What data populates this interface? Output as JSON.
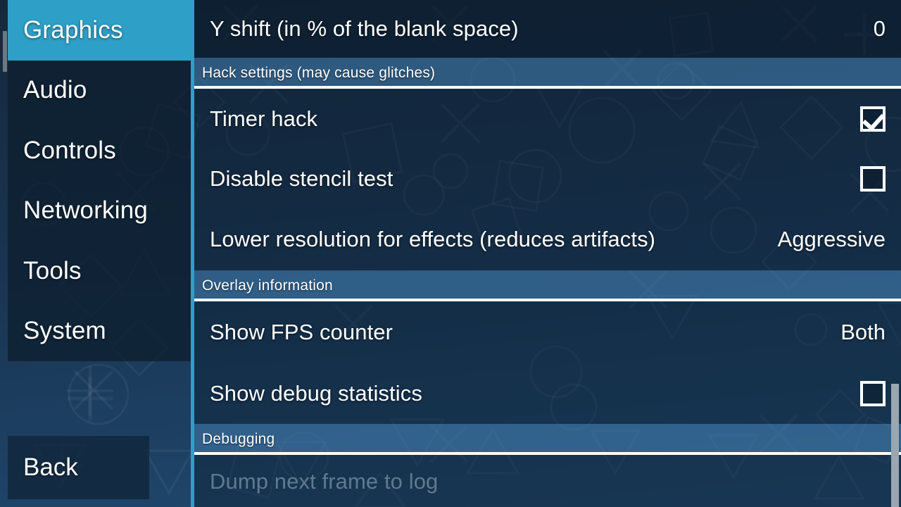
{
  "app": {
    "title": "PPSSPP Graphics Settings",
    "accent_color": "#2e9fc6",
    "panel_color": "#0e1f30",
    "section_header_color": "#3e76a4",
    "text_color": "#ffffff",
    "disabled_text_color": "#61798f"
  },
  "sidebar": {
    "items": [
      {
        "label": "Graphics",
        "selected": true
      },
      {
        "label": "Audio",
        "selected": false
      },
      {
        "label": "Controls",
        "selected": false
      },
      {
        "label": "Networking",
        "selected": false
      },
      {
        "label": "Tools",
        "selected": false
      },
      {
        "label": "System",
        "selected": false
      }
    ],
    "back_label": "Back"
  },
  "content": {
    "rows": [
      {
        "id": "y-shift",
        "kind": "value",
        "label": "Y shift (in % of the blank space)",
        "value": "0"
      },
      {
        "id": "hack-settings",
        "kind": "section",
        "label": "Hack settings (may cause glitches)"
      },
      {
        "id": "timer-hack",
        "kind": "checkbox",
        "label": "Timer hack",
        "checked": true
      },
      {
        "id": "disable-stencil-test",
        "kind": "checkbox",
        "label": "Disable stencil test",
        "checked": false
      },
      {
        "id": "lower-resolution-for-effects",
        "kind": "value",
        "label": "Lower resolution for effects (reduces artifacts)",
        "value": "Aggressive"
      },
      {
        "id": "overlay-information",
        "kind": "section",
        "label": "Overlay information"
      },
      {
        "id": "show-fps-counter",
        "kind": "value",
        "label": "Show FPS counter",
        "value": "Both"
      },
      {
        "id": "show-debug-statistics",
        "kind": "checkbox",
        "label": "Show debug statistics",
        "checked": false
      },
      {
        "id": "debugging",
        "kind": "section",
        "label": "Debugging"
      },
      {
        "id": "dump-next-frame-to-log",
        "kind": "disabled",
        "label": "Dump next frame to log"
      }
    ]
  },
  "scrollbars": {
    "left_visible": true,
    "right_visible": true
  }
}
